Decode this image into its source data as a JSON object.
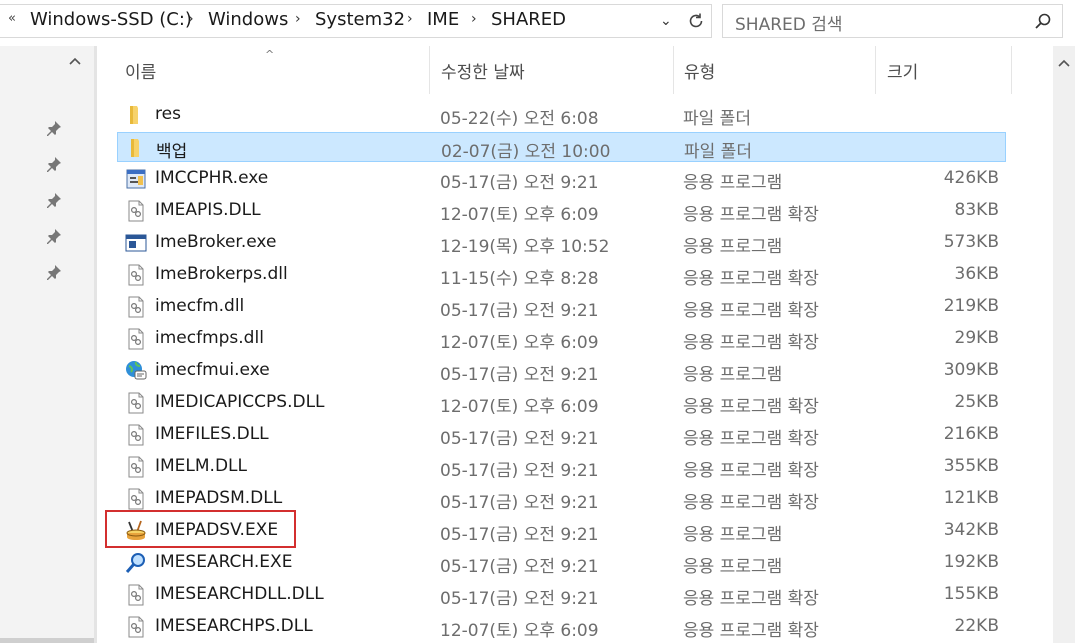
{
  "address": {
    "more": "«",
    "crumbs": [
      "Windows-SSD (C:)",
      "Windows",
      "System32",
      "IME",
      "SHARED"
    ]
  },
  "search": {
    "placeholder": "SHARED 검색"
  },
  "columns": {
    "name": "이름",
    "date": "수정한 날짜",
    "type": "유형",
    "size": "크기"
  },
  "files": [
    {
      "name": "res",
      "date": "05-22(수) 오전 6:08",
      "type": "파일 폴더",
      "size": "",
      "icon": "folder-icon"
    },
    {
      "name": "백업",
      "date": "02-07(금) 오전 10:00",
      "type": "파일 폴더",
      "size": "",
      "icon": "folder-icon",
      "selected": true
    },
    {
      "name": "IMCCPHR.exe",
      "date": "05-17(금) 오전 9:21",
      "type": "응용 프로그램",
      "size": "426KB",
      "icon": "app-dialog-icon"
    },
    {
      "name": "IMEAPIS.DLL",
      "date": "12-07(토) 오후 6:09",
      "type": "응용 프로그램 확장",
      "size": "83KB",
      "icon": "dll-icon"
    },
    {
      "name": "ImeBroker.exe",
      "date": "12-19(목) 오후 10:52",
      "type": "응용 프로그램",
      "size": "573KB",
      "icon": "app-window-icon"
    },
    {
      "name": "ImeBrokerps.dll",
      "date": "11-15(수) 오후 8:28",
      "type": "응용 프로그램 확장",
      "size": "36KB",
      "icon": "dll-icon"
    },
    {
      "name": "imecfm.dll",
      "date": "05-17(금) 오전 9:21",
      "type": "응용 프로그램 확장",
      "size": "219KB",
      "icon": "dll-icon"
    },
    {
      "name": "imecfmps.dll",
      "date": "12-07(토) 오후 6:09",
      "type": "응용 프로그램 확장",
      "size": "29KB",
      "icon": "dll-icon"
    },
    {
      "name": "imecfmui.exe",
      "date": "05-17(금) 오전 9:21",
      "type": "응용 프로그램",
      "size": "309KB",
      "icon": "globe-chat-icon"
    },
    {
      "name": "IMEDICAPICCPS.DLL",
      "date": "12-07(토) 오후 6:09",
      "type": "응용 프로그램 확장",
      "size": "25KB",
      "icon": "dll-icon"
    },
    {
      "name": "IMEFILES.DLL",
      "date": "05-17(금) 오전 9:21",
      "type": "응용 프로그램 확장",
      "size": "216KB",
      "icon": "dll-icon"
    },
    {
      "name": "IMELM.DLL",
      "date": "05-17(금) 오전 9:21",
      "type": "응용 프로그램 확장",
      "size": "355KB",
      "icon": "dll-icon"
    },
    {
      "name": "IMEPADSM.DLL",
      "date": "05-17(금) 오전 9:21",
      "type": "응용 프로그램 확장",
      "size": "121KB",
      "icon": "dll-icon"
    },
    {
      "name": "IMEPADSV.EXE",
      "date": "05-17(금) 오전 9:21",
      "type": "응용 프로그램",
      "size": "342KB",
      "icon": "brush-pot-icon"
    },
    {
      "name": "IMESEARCH.EXE",
      "date": "05-17(금) 오전 9:21",
      "type": "응용 프로그램",
      "size": "192KB",
      "icon": "magnifier-icon"
    },
    {
      "name": "IMESEARCHDLL.DLL",
      "date": "05-17(금) 오전 9:21",
      "type": "응용 프로그램 확장",
      "size": "155KB",
      "icon": "dll-icon"
    },
    {
      "name": "IMESEARCHPS.DLL",
      "date": "12-07(토) 오후 6:09",
      "type": "응용 프로그램 확장",
      "size": "22KB",
      "icon": "dll-icon"
    }
  ]
}
